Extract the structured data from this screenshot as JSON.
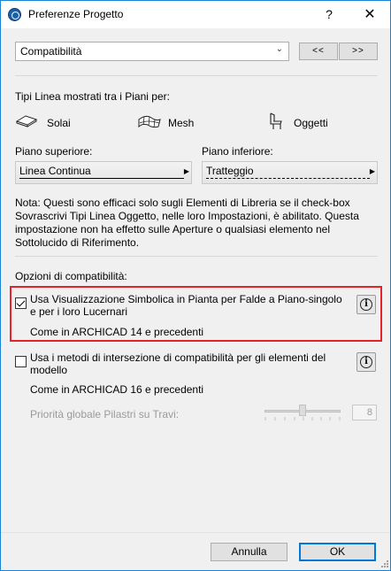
{
  "window": {
    "title": "Preferenze Progetto",
    "help_label": "?",
    "close_label": "✕"
  },
  "header": {
    "selected_page": "Compatibilità",
    "prev_label": "<<",
    "next_label": ">>"
  },
  "linetypes": {
    "heading": "Tipi Linea mostrati tra i Piani per:",
    "items": [
      {
        "label": "Solai",
        "icon": "slab-icon"
      },
      {
        "label": "Mesh",
        "icon": "mesh-icon"
      },
      {
        "label": "Oggetti",
        "icon": "chair-icon"
      }
    ],
    "upper_label": "Piano superiore:",
    "upper_value": "Linea Continua",
    "lower_label": "Piano inferiore:",
    "lower_value": "Tratteggio",
    "note": "Nota: Questi sono efficaci solo sugli Elementi di Libreria se il check-box Sovrascrivi Tipi Linea Oggetto, nelle loro Impostazioni, è abilitato. Questa impostazione non ha effetto sulle Aperture o qualsiasi elemento nel Sottolucido di Riferimento."
  },
  "compat": {
    "heading": "Opzioni di compatibilità:",
    "option1_text": "Usa Visualizzazione Simbolica in Pianta per Falde a Piano-singolo e per i loro Lucernari",
    "option1_checked": true,
    "option1_note": "Come in ARCHICAD 14 e precedenti",
    "option2_text": "Usa i metodi di intersezione di compatibilità per gli elementi del modello",
    "option2_checked": false,
    "option2_note": "Come in ARCHICAD 16 e precedenti",
    "priority_label": "Priorità globale Pilastri su Travi:",
    "priority_value": "8",
    "highlight_color": "#e8212b"
  },
  "footer": {
    "cancel_label": "Annulla",
    "ok_label": "OK"
  }
}
